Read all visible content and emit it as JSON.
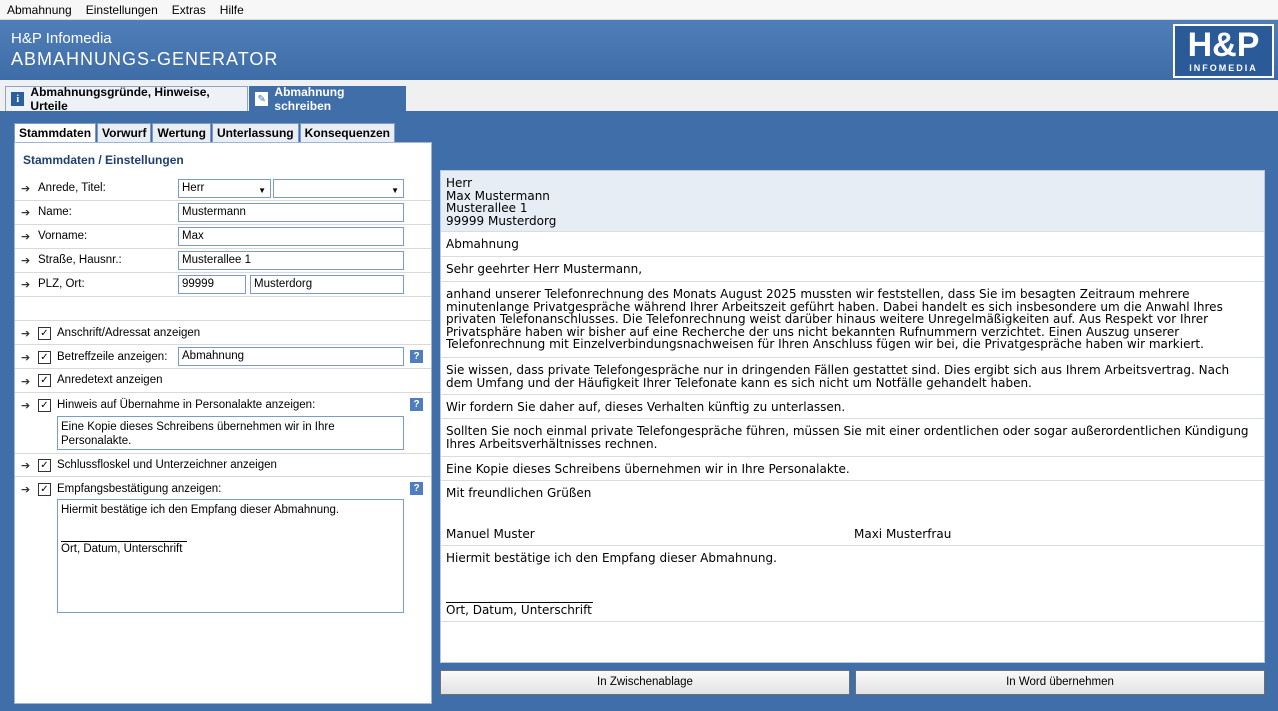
{
  "menu": [
    "Abmahnung",
    "Einstellungen",
    "Extras",
    "Hilfe"
  ],
  "banner": {
    "subtitle": "H&P Infomedia",
    "title": "ABMAHNUNGS-GENERATOR",
    "logo_big": "H&P",
    "logo_small": "INFOMEDIA"
  },
  "outer_tabs": [
    {
      "label": "Abmahnungsgründe, Hinweise, Urteile",
      "icon": "info-icon",
      "active": false
    },
    {
      "label": "Abmahnung schreiben",
      "icon": "edit-icon",
      "active": true
    }
  ],
  "inner_tabs": [
    {
      "label": "Stammdaten",
      "active": true
    },
    {
      "label": "Vorwurf",
      "active": false
    },
    {
      "label": "Wertung",
      "active": false
    },
    {
      "label": "Unterlassung",
      "active": false
    },
    {
      "label": "Konsequenzen",
      "active": false
    }
  ],
  "form": {
    "heading": "Stammdaten / Einstellungen",
    "anrede_label": "Anrede, Titel:",
    "anrede_value": "Herr",
    "titel_value": "",
    "name_label": "Name:",
    "name_value": "Mustermann",
    "vorname_label": "Vorname:",
    "vorname_value": "Max",
    "strasse_label": "Straße, Hausnr.:",
    "strasse_value": "Musterallee 1",
    "plz_label": "PLZ, Ort:",
    "plz_value": "99999",
    "ort_value": "Musterdorg",
    "cb_anschrift": "Anschrift/Adressat anzeigen",
    "cb_betreff": "Betreffzeile anzeigen:",
    "betreff_value": "Abmahnung",
    "cb_anrede": "Anredetext anzeigen",
    "cb_personalakte": "Hinweis auf Übernahme in Personalakte anzeigen:",
    "personalakte_text": "Eine Kopie dieses Schreibens übernehmen wir in Ihre Personalakte.",
    "cb_schluss": "Schlussfloskel und Unterzeichner anzeigen",
    "cb_empfang": "Empfangsbestätigung anzeigen:",
    "empfang_text": "Hiermit bestätige ich den Empfang dieser Abmahnung.",
    "empfang_sign": "Ort, Datum, Unterschrift",
    "check_mark": "✓",
    "help_mark": "?"
  },
  "document": {
    "address": [
      "Herr",
      "Max Mustermann",
      "Musterallee 1",
      "99999 Musterdorg"
    ],
    "subject": "Abmahnung",
    "salutation": "Sehr geehrter Herr Mustermann,",
    "para1": "anhand unserer Telefonrechnung des Monats August 2025 mussten wir feststellen, dass Sie im besagten Zeitraum mehrere minutenlange Privatgespräche während Ihrer Arbeitszeit geführt haben. Dabei handelt es sich insbesondere um die Anwahl Ihres privaten Telefonanschlusses. Die Telefonrechnung weist darüber hinaus weitere Unregelmäßigkeiten auf. Aus Respekt vor Ihrer Privatsphäre haben wir bisher auf eine Recherche der uns nicht bekannten Rufnummern verzichtet. Einen Auszug unserer Telefonrechnung mit Einzelverbindungsnachweisen für Ihren Anschluss fügen wir bei, die Privatgespräche haben wir markiert.",
    "para2": "Sie wissen, dass private Telefongespräche nur in dringenden Fällen gestattet sind. Dies ergibt sich aus Ihrem Arbeitsvertrag. Nach dem Umfang und der Häufigkeit Ihrer Telefonate kann es sich nicht um Notfälle gehandelt haben.",
    "para3": "Wir fordern Sie daher auf, dieses Verhalten künftig zu unterlassen.",
    "para4": "Sollten Sie noch einmal private Telefongespräche führen, müssen Sie mit einer ordentlichen oder sogar außerordentlichen Kündigung Ihres Arbeitsverhältnisses rechnen.",
    "para5": "Eine Kopie dieses Schreibens übernehmen wir in Ihre Personalakte.",
    "closing": "Mit freundlichen Grüßen",
    "signer1": "Manuel Muster",
    "signer2": "Maxi Musterfrau",
    "receipt": "Hiermit bestätige ich den Empfang dieser Abmahnung.",
    "receipt_sign": "Ort, Datum, Unterschrift"
  },
  "buttons": {
    "clipboard": "In Zwischenablage",
    "word": "In Word übernehmen"
  }
}
